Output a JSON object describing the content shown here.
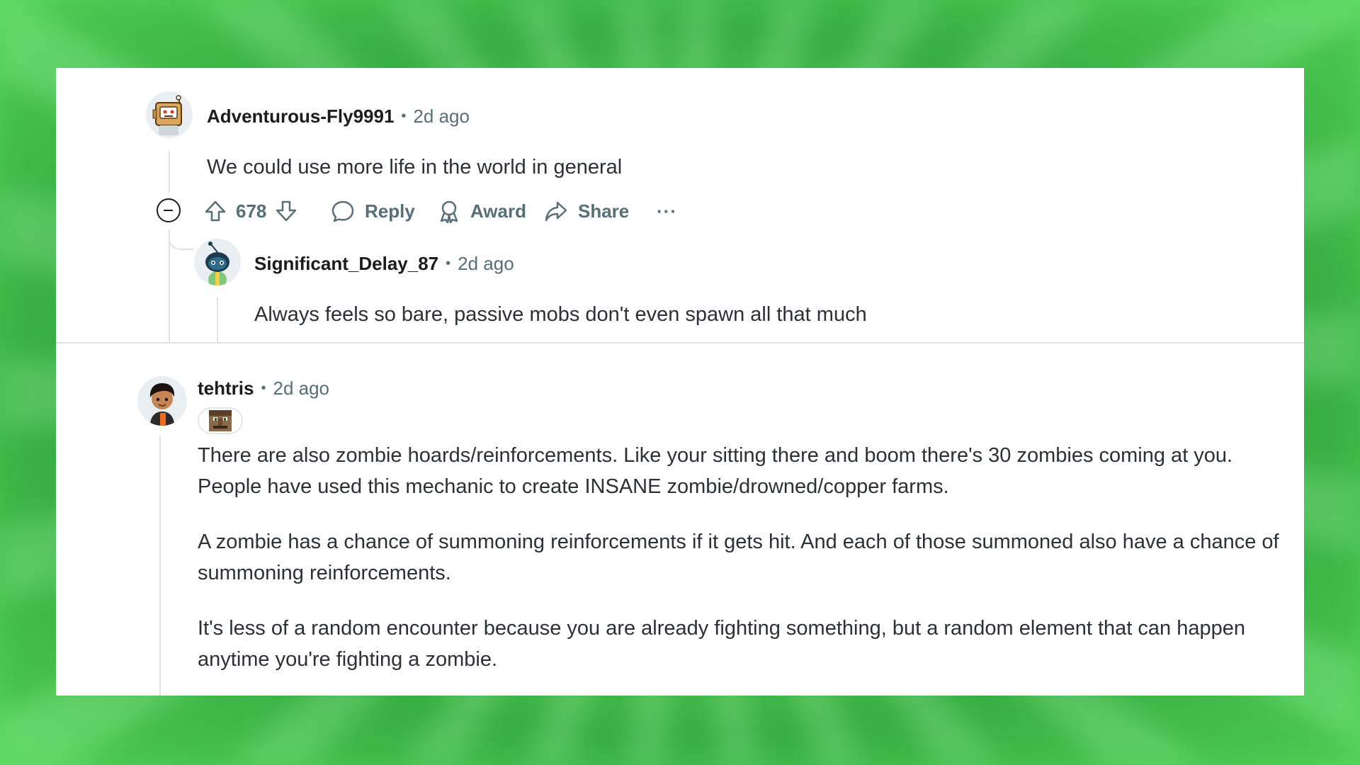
{
  "comments": [
    {
      "username": "Adventurous-Fly9991",
      "separator": "•",
      "time": "2d ago",
      "body": "We could use more life in the world in general",
      "actions": {
        "upvotes": "678",
        "reply_label": "Reply",
        "award_label": "Award",
        "share_label": "Share",
        "more_label": "···"
      },
      "replies": [
        {
          "username": "Significant_Delay_87",
          "separator": "•",
          "time": "2d ago",
          "body": "Always feels so bare, passive mobs don't even spawn all that much"
        }
      ]
    },
    {
      "username": "tehtris",
      "separator": "•",
      "time": "2d ago",
      "has_flair": true,
      "paragraphs": [
        "There are also zombie hoards/reinforcements. Like your sitting there and boom there's 30 zombies coming at you. People have used this mechanic to create INSANE zombie/drowned/copper farms.",
        "A zombie has a chance of summoning reinforcements if it gets hit. And each of those summoned also have a chance of summoning reinforcements.",
        "It's less of a random encounter because you are already fighting something, but a random element that can happen anytime you're fighting a zombie."
      ]
    }
  ],
  "colors": {
    "background": "#5fdc5f",
    "card": "#ffffff",
    "text": "#2a3236",
    "muted": "#576f76",
    "divider": "#dfe3e6"
  }
}
